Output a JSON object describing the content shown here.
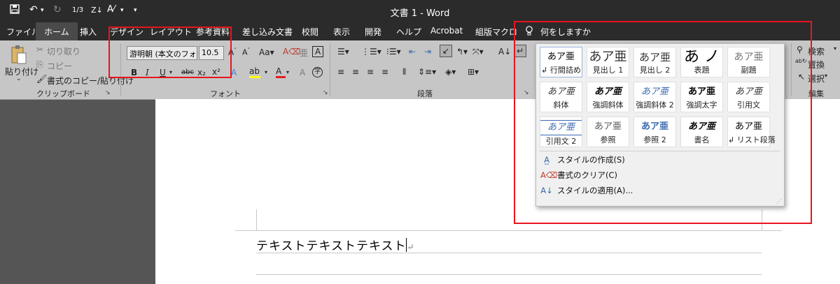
{
  "titlebar": {
    "save_icon": "save-icon",
    "undo_icon": "undo-icon",
    "redo_icon": "redo-icon",
    "document_title": "文書 1  -  Word"
  },
  "tabs": [
    "ファイル",
    "ホーム",
    "挿入",
    "デザイン",
    "レイアウト",
    "参考資料",
    "差し込み文書",
    "校閲",
    "表示",
    "開発",
    "ヘルプ",
    "Acrobat",
    "組版マクロ"
  ],
  "tell_me": "何をしますか",
  "clipboard": {
    "paste": "貼り付け",
    "cut": "切り取り",
    "copy": "コピー",
    "format_painter": "書式のコピー/貼り付け",
    "group_label": "クリップボード"
  },
  "font": {
    "font_name": "游明朝 (本文のフォ",
    "font_size": "10.5",
    "bold": "B",
    "italic": "I",
    "underline": "U",
    "strike": "abc",
    "subscript": "x₂",
    "superscript": "x²",
    "group_label": "フォント"
  },
  "paragraph": {
    "group_label": "段落"
  },
  "editing": {
    "find": "検索",
    "replace": "置換",
    "select": "選択",
    "group_label": "編集"
  },
  "styles_gallery": {
    "tiles": [
      {
        "sample": "あア亜",
        "name": "↲ 行間詰め"
      },
      {
        "sample": "あア亜",
        "name": "見出し 1"
      },
      {
        "sample": "あア亜",
        "name": "見出し 2"
      },
      {
        "sample": "あ ノ",
        "name": "表題"
      },
      {
        "sample": "あア亜",
        "name": "副題"
      },
      {
        "sample": "あア亜",
        "name": "斜体"
      },
      {
        "sample": "あア亜",
        "name": "強調斜体"
      },
      {
        "sample": "あア亜",
        "name": "強調斜体 2"
      },
      {
        "sample": "あア亜",
        "name": "強調太字"
      },
      {
        "sample": "あア亜",
        "name": "引用文"
      },
      {
        "sample": "あア亜",
        "name": "引用文 2"
      },
      {
        "sample": "あア亜",
        "name": "参照"
      },
      {
        "sample": "あア亜",
        "name": "参照 2"
      },
      {
        "sample": "あア亜",
        "name": "書名"
      },
      {
        "sample": "あア亜",
        "name": "↲ リスト段落"
      }
    ],
    "menu": [
      {
        "label": "スタイルの作成(S)",
        "icon": "create-style-icon"
      },
      {
        "label": "書式のクリア(C)",
        "icon": "clear-formatting-icon"
      },
      {
        "label": "スタイルの適用(A)...",
        "icon": "apply-styles-icon"
      }
    ]
  },
  "document": {
    "text": "テキストテキストテキスト",
    "paragraph_mark": "↵"
  },
  "colors": {
    "highlight_box": "#e8141f",
    "titlebar_bg": "#2b2b2b",
    "ribbon_bg": "#c6c6c6",
    "font_color_red": "#e51c23",
    "highlight_yellow": "#ffff00"
  }
}
